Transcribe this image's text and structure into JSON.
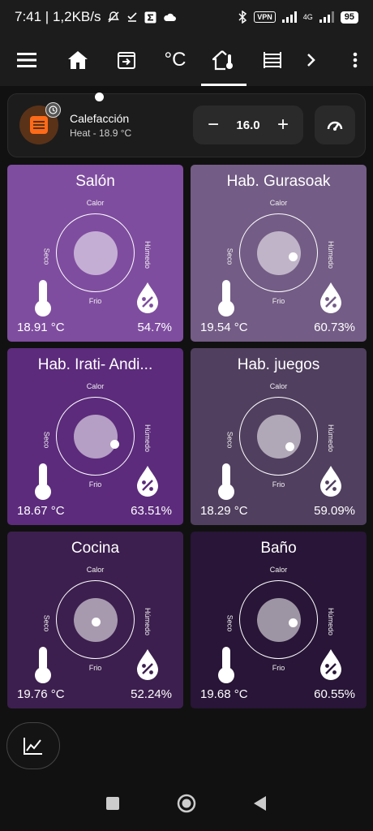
{
  "status_bar": {
    "time_speed": "7:41 | 1,2KB/s",
    "vpn": "VPN",
    "network": "4G",
    "battery": "95"
  },
  "app_bar": {
    "tabs": [
      {
        "icon": "home-icon"
      },
      {
        "icon": "entrance-icon"
      },
      {
        "icon": "celsius-icon",
        "label": "°C"
      },
      {
        "icon": "home-thermometer-icon",
        "active": true
      },
      {
        "icon": "radiator-icon"
      }
    ]
  },
  "heating": {
    "title": "Calefacción",
    "status": "Heat - 18.9 °C",
    "setpoint": "16.0",
    "minus": "−",
    "plus": "+",
    "icon_color": "#ff6a18"
  },
  "comfort_labels": {
    "hot": "Calor",
    "cold": "Frio",
    "dry": "Seco",
    "humid": "Húmedo"
  },
  "rooms": [
    {
      "name": "Salón",
      "temperature": "18.91 °C",
      "humidity": "54.7%",
      "color": "#7f4d9f"
    },
    {
      "name": "Hab. Gurasoak",
      "temperature": "19.54 °C",
      "humidity": "60.73%",
      "color": "#735c85"
    },
    {
      "name": "Hab. Irati- Andi...",
      "temperature": "18.67 °C",
      "humidity": "63.51%",
      "color": "#5c2b7c"
    },
    {
      "name": "Hab. juegos",
      "temperature": "18.29 °C",
      "humidity": "59.09%",
      "color": "#503f5f"
    },
    {
      "name": "Cocina",
      "temperature": "19.76 °C",
      "humidity": "52.24%",
      "color": "#3c1f4e"
    },
    {
      "name": "Baño",
      "temperature": "19.68 °C",
      "humidity": "60.55%",
      "color": "#281537"
    }
  ]
}
